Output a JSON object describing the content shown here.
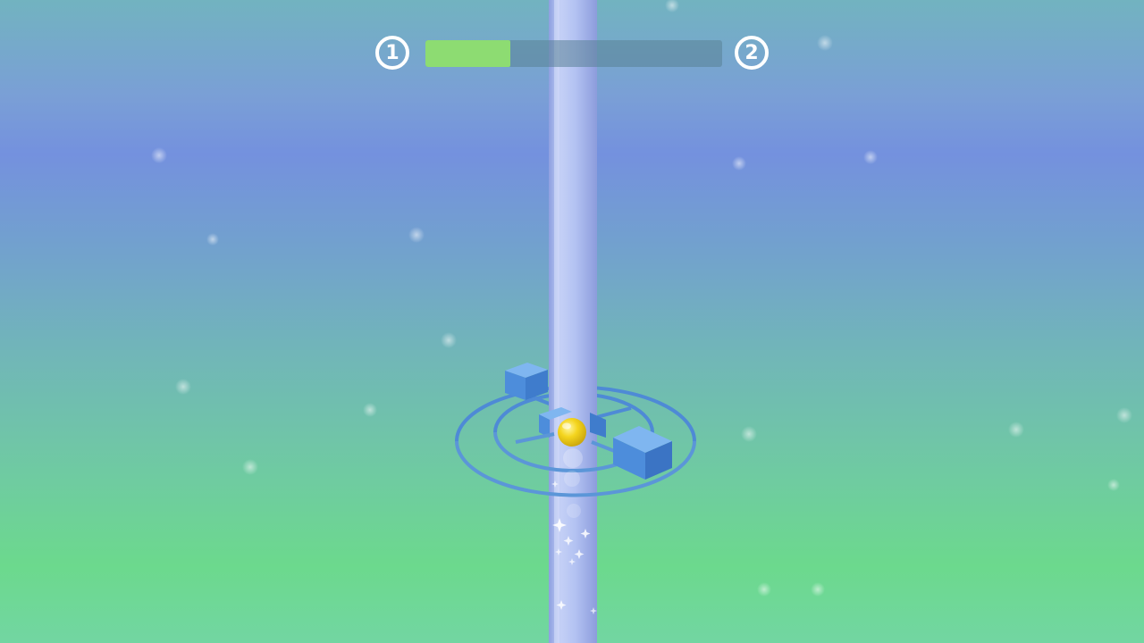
{
  "hud": {
    "current_level": "1",
    "next_level": "2",
    "progress_fraction": 0.285
  },
  "colors": {
    "progress_fill": "#8ddc72",
    "ball": "#f4d51e",
    "platform": "#5b96d8",
    "pole": "#b8c8f2"
  }
}
